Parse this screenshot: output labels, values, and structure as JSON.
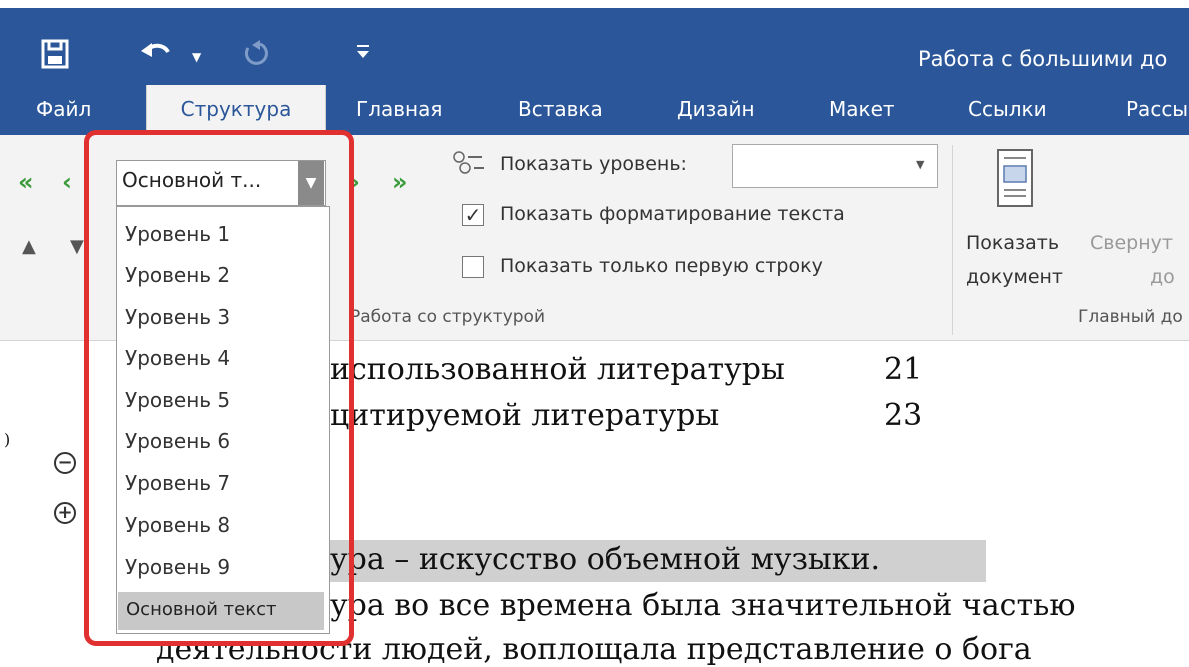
{
  "title_bar": {
    "title": "Работа с большими до",
    "icons": [
      "save-icon",
      "undo-icon",
      "redo-icon",
      "customize-qat-icon"
    ]
  },
  "tabs": [
    {
      "label": "Файл",
      "active": false
    },
    {
      "label": "Структура",
      "active": true
    },
    {
      "label": "Главная",
      "active": false
    },
    {
      "label": "Вставка",
      "active": false
    },
    {
      "label": "Дизайн",
      "active": false
    },
    {
      "label": "Макет",
      "active": false
    },
    {
      "label": "Ссылки",
      "active": false
    },
    {
      "label": "Рассы",
      "active": false
    }
  ],
  "ribbon": {
    "outline_level": {
      "value": "Основной т...",
      "options": [
        "Уровень 1",
        "Уровень 2",
        "Уровень 3",
        "Уровень 4",
        "Уровень 5",
        "Уровень 6",
        "Уровень 7",
        "Уровень 8",
        "Уровень 9",
        "Основной текст"
      ],
      "selected": "Основной текст"
    },
    "show_level_label": "Показать уровень:",
    "show_formatting_label": "Показать форматирование текста",
    "show_formatting_checked": true,
    "first_line_only_label": "Показать только первую строку",
    "first_line_only_checked": false,
    "outline_group_label": "Работа со структурой",
    "show_document_line1": "Показать",
    "show_document_line2": "документ",
    "collapse_line1": "Свернут",
    "collapse_line2": "до",
    "master_group_label": "Главный до",
    "colors": {
      "brand": "#2b579a",
      "highlight": "#e03030",
      "green_arrow": "#3a9a3a"
    }
  },
  "document": {
    "lines": [
      {
        "text": "использованной литературы",
        "page": "21"
      },
      {
        "text": "цитируемой литературы",
        "page": "23"
      }
    ],
    "heading": "ура – искусство объемной музыки.",
    "body_line1": "ура во все времена была значительной частью",
    "body_line2": "деятельности людей, воплощала представление о бога",
    "side_mark": ")"
  }
}
